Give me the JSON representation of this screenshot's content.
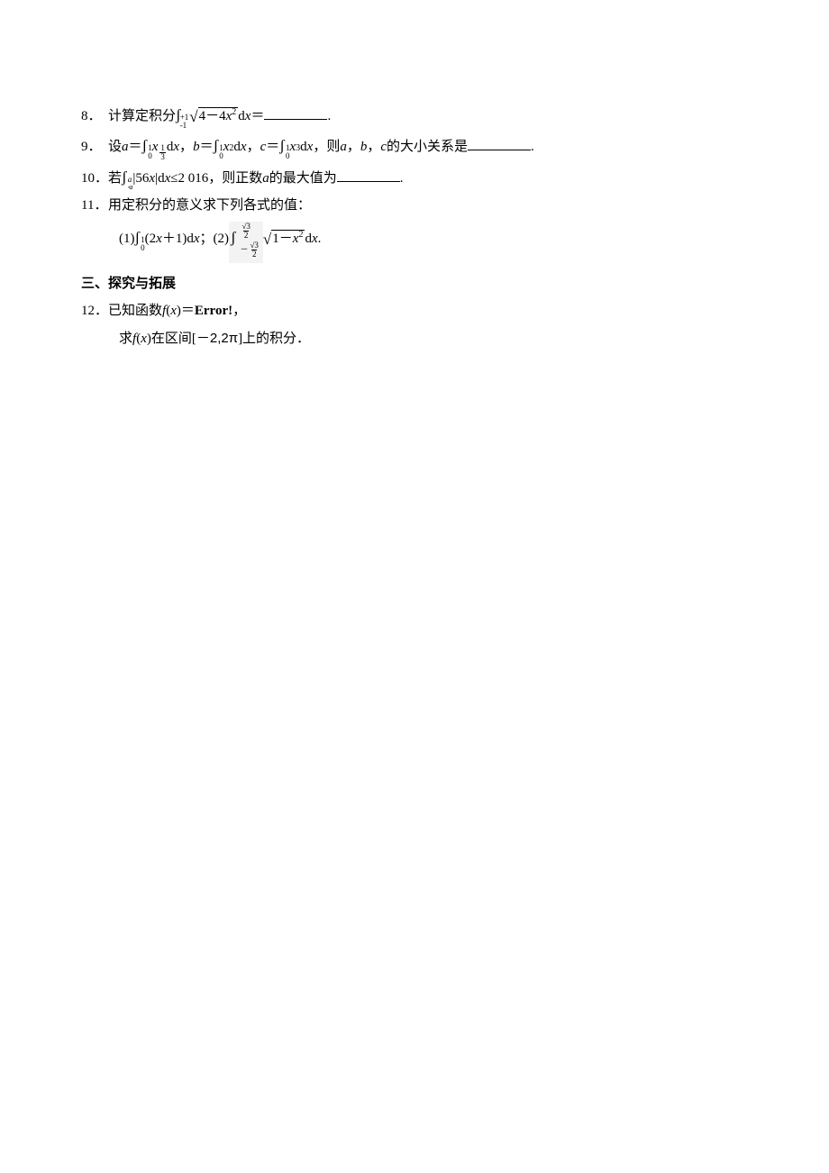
{
  "q8": {
    "num": "8．",
    "t1": "计算定积分",
    "int": "ʃ",
    "sup1": "+1",
    "sub1": "-1",
    "rad_inner_a": "4－4",
    "rad_inner_b": "x",
    "rad_inner_c": "2",
    "dx": "d",
    "x": "x",
    "eq": "＝",
    "dot": "."
  },
  "q9": {
    "num": "9．",
    "t1": "设 ",
    "a": "a",
    "eq1": "＝",
    "int": "ʃ",
    "sup0": "1",
    "sub0": "0",
    "x": "x",
    "expA_n": "1",
    "expA_d": "3",
    "dx": "d",
    "comma": "，",
    "b": "b",
    "sup2": "2",
    "c": "c",
    "sup3": "3",
    "t2": "，则 ",
    "t3": "，",
    "t4": " 的大小关系是",
    "dot": "."
  },
  "q10": {
    "num": "10．",
    "t1": "若 ",
    "int": "ʃ",
    "sup": "a",
    "sub": "-a",
    "bar1": "|56",
    "x": "x",
    "bar2": "|d",
    "le": "≤",
    "val": "2 016",
    "t2": "，则正数 ",
    "a": "a",
    "t3": " 的最大值为",
    "dot": "."
  },
  "q11": {
    "num": "11．",
    "t1": "用定积分的意义求下列各式的值：",
    "p1_label": "(1)",
    "int": "ʃ",
    "sup0": "1",
    "sub0": "0",
    "p1_body": "(2",
    "x": "x",
    "p1_body2": "＋1)d",
    "semi": "； ",
    "p2_label": "(2)",
    "lim_top_n": "√3",
    "lim_top_d": "2",
    "minus": "－",
    "lim_bot_n": "√3",
    "lim_bot_d": "2",
    "rad_a": "1－",
    "rad_b": "x",
    "rad_c": "2",
    "dx": "d",
    "dot": "."
  },
  "section": "三、探究与拓展",
  "q12": {
    "num": "12．",
    "t1": "已知函数 ",
    "f": "f",
    "paren_o": "(",
    "x": "x",
    "paren_c": ")",
    "eq": "＝",
    "err": "Error!",
    "comma": "，",
    "t2": "求 ",
    "t3": "在区间[－",
    "k1": "2,2π",
    "t4": "]上的积分．"
  }
}
